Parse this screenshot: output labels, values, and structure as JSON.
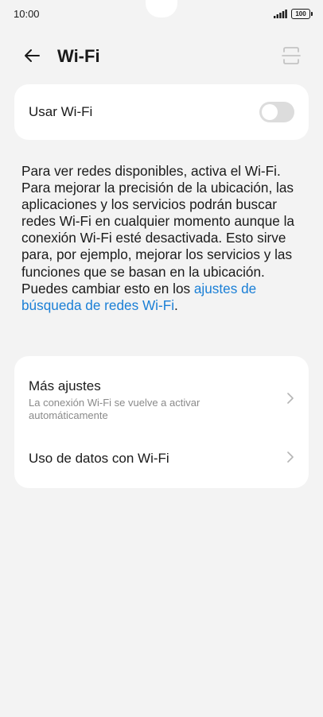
{
  "status_bar": {
    "time": "10:00",
    "battery": "100",
    "icons": [
      "signal-icon",
      "battery-icon"
    ]
  },
  "header": {
    "title": "Wi-Fi",
    "icons": [
      "back-arrow-icon",
      "qr-scan-icon"
    ]
  },
  "wifi_toggle": {
    "label": "Usar Wi-Fi",
    "state": "off"
  },
  "info": {
    "text": "Para ver redes disponibles, activa el Wi-Fi. Para mejorar la precisión de la ubicación, las aplicaciones y los servicios podrán buscar redes Wi-Fi en cualquier momento aunque la conexión Wi-Fi esté desactivada. Esto sirve para, por ejemplo, mejorar los servicios y las funciones que se basan en la ubicación. Puedes cambiar esto en los ",
    "link_text": "ajustes de búsqueda de redes Wi-Fi",
    "suffix": "."
  },
  "settings_list": [
    {
      "title": "Más ajustes",
      "subtitle": "La conexión Wi-Fi se vuelve a activar automáticamente"
    },
    {
      "title": "Uso de datos con Wi-Fi"
    }
  ],
  "colors": {
    "background": "#f3f3f3",
    "card": "#ffffff",
    "link": "#1a7fd6",
    "toggle_off": "#dcdcdc",
    "secondary_text": "#8a8a8a"
  }
}
